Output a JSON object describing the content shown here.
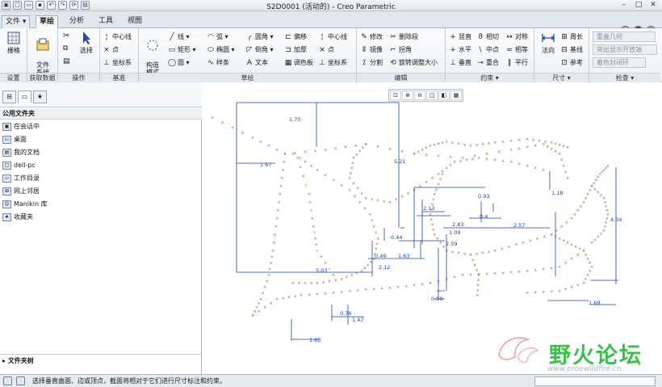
{
  "title": "S2D0001 (活动的) - Creo Parametric",
  "tabs": [
    "文件",
    "草绘",
    "分析",
    "工具",
    "视图"
  ],
  "ribbon": {
    "group_labels": [
      "设置",
      "获取数据",
      "操作",
      "基准",
      "草绘",
      "编辑",
      "约束",
      "尺寸",
      "检查"
    ],
    "setup": {
      "grid": "栅格"
    },
    "getdata": {
      "file_system": "文件\n系统"
    },
    "operations": {
      "select": "选择"
    },
    "datum": {
      "centerline": "中心线",
      "point": "点",
      "csys": "坐标系"
    },
    "construction_mode": "构造\n模式",
    "sketch": {
      "col1": [
        "线",
        "矩形",
        "圆"
      ],
      "col2": [
        "弧",
        "椭圆",
        "样条"
      ],
      "col3": [
        "圆角",
        "倒角",
        "文本"
      ],
      "col4": [
        "偏移",
        "加厚",
        "调色板"
      ],
      "col5": [
        "中心线",
        "点",
        "坐标系"
      ]
    },
    "edit": {
      "col1": [
        "修改",
        "镜像",
        "分割"
      ],
      "col2": [
        "删除段",
        "拐角",
        "旋转调整大小"
      ]
    },
    "constrain": {
      "col1": [
        "竖直",
        "水平",
        "垂直"
      ],
      "col2": [
        "相切",
        "中点",
        "重合"
      ],
      "col3": [
        "对称",
        "相等",
        "平行"
      ]
    },
    "dimension": {
      "normal": "法向",
      "col2": [
        "周长",
        "基线",
        "参考"
      ]
    },
    "inspect": {
      "items": [
        "重叠几何",
        "突出显示开放端",
        "着色封闭环"
      ]
    }
  },
  "left_panel": {
    "favorites_header": "公用文件夹",
    "favorites": [
      "在会话中",
      "桌面",
      "我的文档",
      "dell-pc",
      "工作目录",
      "网上邻居",
      "Manikin 库",
      "收藏夹"
    ],
    "tree_header": "文件夹树"
  },
  "dimensions": [
    "1.75",
    "1.67",
    "5.21",
    "2.13",
    "0.93",
    "1.18",
    "4.04",
    "2.57",
    "2.83",
    "1.09",
    "0.44",
    "2.59",
    "2.12",
    "0.49",
    "1.63",
    "5.03",
    "0.08",
    "0.76",
    "1.47",
    "1.65",
    "1.69",
    "0.4"
  ],
  "status": {
    "message": "选择垂直曲面、边或顶点，截面将相对于它们进行尺寸标注和约束。"
  },
  "watermark": {
    "text": "野火论坛",
    "url": "www.proewildfire.cn"
  }
}
